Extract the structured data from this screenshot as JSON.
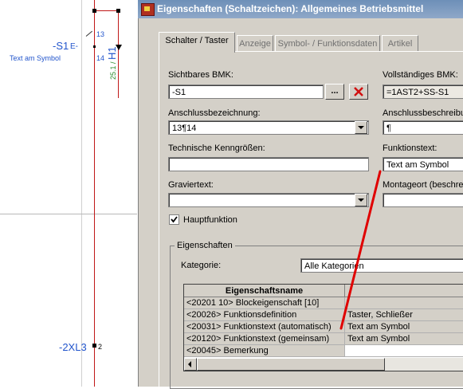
{
  "colors": {
    "wire": "#c01818",
    "bmk": "#2255cc",
    "annotation_line": "#e00000",
    "title_bar": "#6d8fb8"
  },
  "schematic": {
    "terminal_top": "13",
    "terminal_bottom": "14",
    "bmk_s1": "-S1",
    "symbol_text": "Text am Symbol",
    "h1_label": "25.1 / H1",
    "xl_label": "-2XL3",
    "xl_pin": "2"
  },
  "dialog": {
    "title": "Eigenschaften (Schaltzeichen): Allgemeines Betriebsmittel",
    "tabs": [
      {
        "label": "Schalter / Taster"
      },
      {
        "label": "Anzeige"
      },
      {
        "label": "Symbol- / Funktionsdaten"
      },
      {
        "label": "Artikel"
      }
    ],
    "fields": {
      "sichtbares_bmk_label": "Sichtbares BMK:",
      "sichtbares_bmk_value": "-S1",
      "browse_label": "...",
      "vollstaendiges_bmk_label": "Vollständiges BMK:",
      "vollstaendiges_bmk_value": "=1AST2+SS-S1",
      "anschlussbez_label": "Anschlussbezeichnung:",
      "anschlussbez_value": "13¶14",
      "anschlussbeschr_label": "Anschlussbeschreibung",
      "anschlussbeschr_value": "¶",
      "kenngroessen_label": "Technische Kenngrößen:",
      "kenngroessen_value": "",
      "funktionstext_label": "Funktionstext:",
      "funktionstext_value": "Text am Symbol",
      "graviertext_label": "Graviertext:",
      "graviertext_value": "",
      "montageort_label": "Montageort (beschrei",
      "montageort_value": "",
      "hauptfunktion_label": "Hauptfunktion",
      "hauptfunktion_checked": true
    },
    "properties": {
      "group_label": "Eigenschaften",
      "kategorie_label": "Kategorie:",
      "kategorie_value": "Alle Kategorien",
      "column_header": "Eigenschaftsname",
      "rows": [
        {
          "name": "<20201 10> Blockeigenschaft [10]",
          "value": ""
        },
        {
          "name": "<20026> Funktionsdefinition",
          "value": "Taster, Schließer"
        },
        {
          "name": "<20031> Funktionstext (automatisch)",
          "value": "Text am Symbol"
        },
        {
          "name": "<20120> Funktionstext (gemeinsam)",
          "value": "Text am Symbol"
        },
        {
          "name": "<20045> Bemerkung",
          "value": ""
        }
      ]
    }
  }
}
